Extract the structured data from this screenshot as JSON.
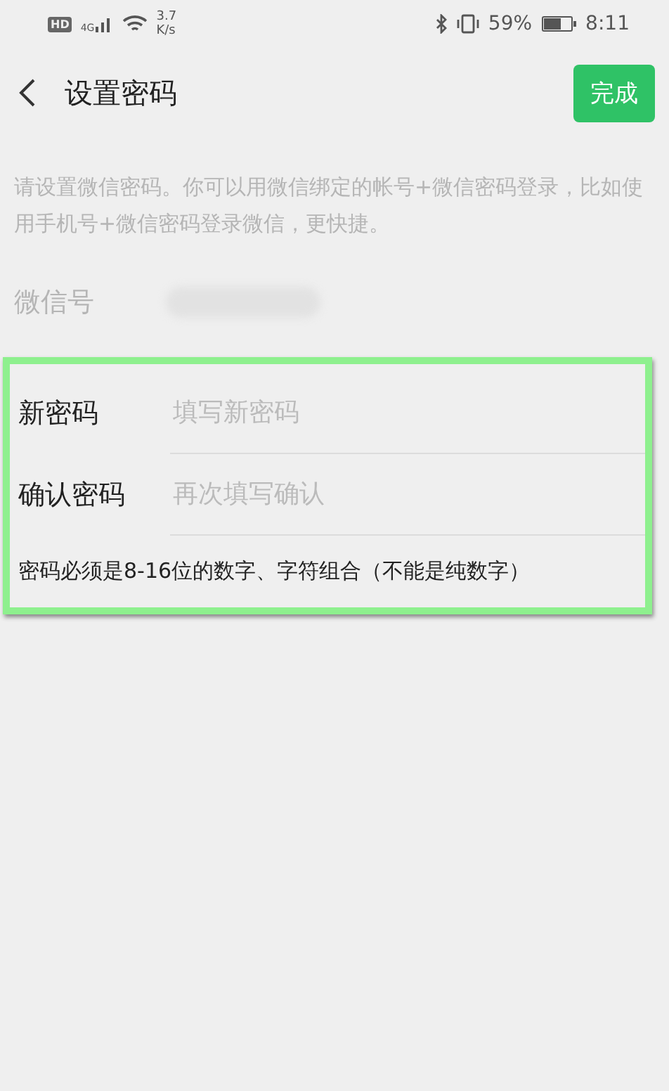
{
  "status_bar": {
    "hd": "HD",
    "network": "4G",
    "speed": "3.7",
    "speed_unit": "K/s",
    "battery": "59%",
    "time": "8:11"
  },
  "header": {
    "title": "设置密码",
    "done_button": "完成"
  },
  "intro": "请设置微信密码。你可以用微信绑定的帐号+微信密码登录，比如使用手机号+微信密码登录微信，更快捷。",
  "wechat_id": {
    "label": "微信号"
  },
  "fields": [
    {
      "label": "新密码",
      "placeholder": "填写新密码"
    },
    {
      "label": "确认密码",
      "placeholder": "再次填写确认"
    }
  ],
  "hint": "密码必须是8-16位的数字、字符组合（不能是纯数字）"
}
